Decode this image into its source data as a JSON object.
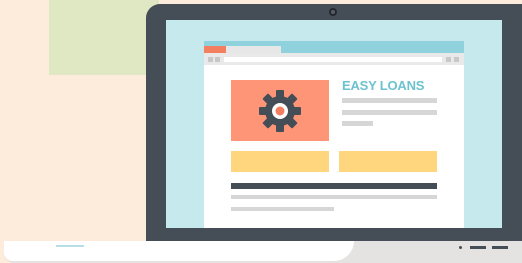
{
  "website": {
    "headline": "EASY LOANS"
  },
  "colors": {
    "background": "#fdebdc",
    "green_accent": "#dfe8c3",
    "laptop_frame": "#454e56",
    "screen": "#c6e9ee",
    "browser_tab_strip": "#8fd1dc",
    "active_tab": "#f47e60",
    "hero_image": "#ff9577",
    "headline": "#6dc2d0",
    "buttons": "#ffd67e"
  },
  "icons": {
    "hero": "gear-icon"
  }
}
